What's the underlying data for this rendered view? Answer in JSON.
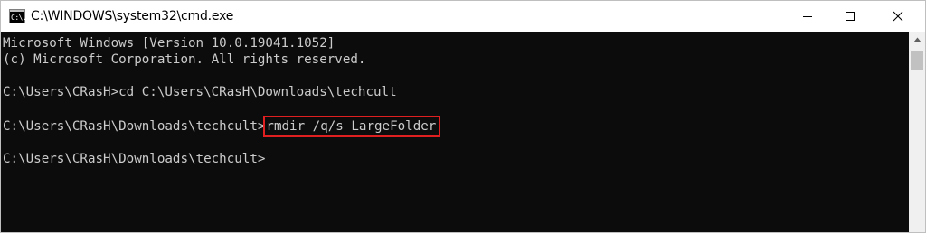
{
  "window": {
    "title": "C:\\WINDOWS\\system32\\cmd.exe",
    "icon": "cmd-console-icon",
    "icon_text": "C:\\."
  },
  "controls": {
    "minimize": "minimize-icon",
    "maximize": "maximize-icon",
    "close": "close-icon"
  },
  "console": {
    "lines": [
      "Microsoft Windows [Version 10.0.19041.1052]",
      "(c) Microsoft Corporation. All rights reserved.",
      "",
      "C:\\Users\\CRasH>cd C:\\Users\\CRasH\\Downloads\\techcult",
      "",
      "C:\\Users\\CRasH\\Downloads\\techcult>",
      "",
      "C:\\Users\\CRasH\\Downloads\\techcult>"
    ],
    "highlighted_command": "rmdir /q/s LargeFolder",
    "highlight_color": "#e02020",
    "text_color": "#cccccc",
    "background_color": "#0c0c0c"
  }
}
